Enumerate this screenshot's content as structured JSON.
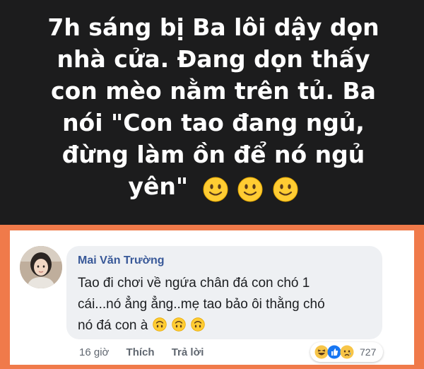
{
  "post": {
    "lines": [
      "7h sáng bị Ba lôi dậy dọn",
      "nhà cửa. Đang dọn thấy",
      "con mèo nằm trên tủ. Ba",
      "nói \"Con tao đang ngủ,",
      "đừng làm ồn để nó ngủ",
      "yên\""
    ],
    "emojis": [
      "slightly-smiling-face",
      "slightly-smiling-face",
      "slightly-smiling-face"
    ],
    "background": "#1c1c1d",
    "text_color": "#ffffff"
  },
  "comment": {
    "author": "Mai Văn Trường",
    "lines": [
      "Tao đi chơi về ngứa chân đá con chó 1",
      "cái...nó ẳng ẳng..mẹ tao bảo ôi thằng chó",
      "nó đá con à"
    ],
    "emojis": [
      "upside-down-face",
      "upside-down-face",
      "upside-down-face"
    ],
    "time": "16 giờ",
    "like_label": "Thích",
    "reply_label": "Trả lời",
    "reaction_icons": [
      "haha-icon",
      "like-icon",
      "sad-icon"
    ],
    "reaction_count": "727",
    "frame_color": "#f07a4a",
    "name_color": "#385898"
  }
}
